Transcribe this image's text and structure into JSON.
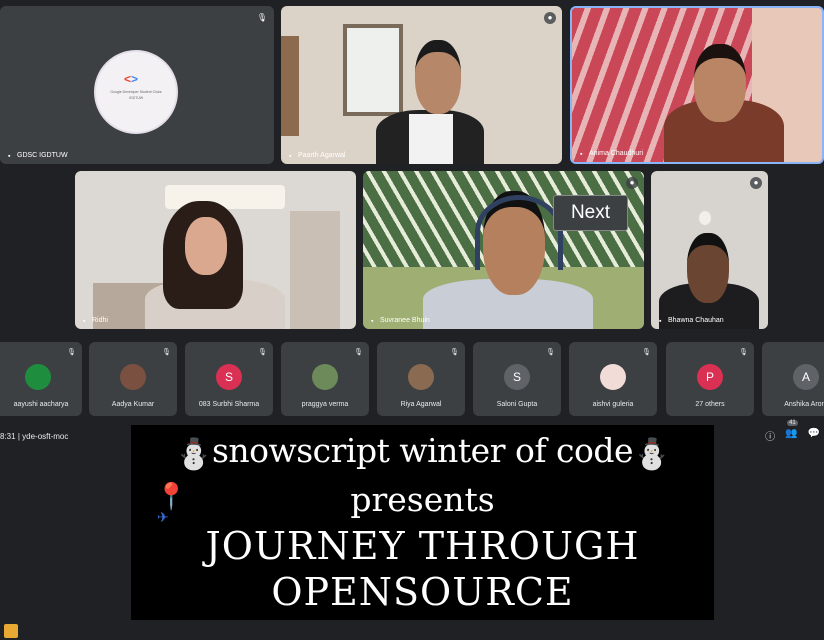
{
  "tiles": {
    "gdsc": {
      "name": "GDSC IGDTUW",
      "logo_text": "Google Developer Student Clubs",
      "logo_sub": "IGDTUW"
    },
    "parth": {
      "name": "Paarth Agarwal"
    },
    "anima": {
      "name": "Anima Chaudhuri"
    },
    "ridhi": {
      "name": "Ridhi"
    },
    "suvranee": {
      "name": "Suvranee Bhuin"
    },
    "bhawna": {
      "name": "Bhawna Chauhan"
    }
  },
  "participants": [
    {
      "name": "aayushi aacharya",
      "initial": "",
      "color": "#1e8e3e"
    },
    {
      "name": "Aadya Kumar",
      "initial": "",
      "color": "#7a5040"
    },
    {
      "name": "083 Surbhi Sharma",
      "initial": "S",
      "color": "#d93054"
    },
    {
      "name": "praggya verma",
      "initial": "",
      "color": "#6d8a5b"
    },
    {
      "name": "Riya Agarwal",
      "initial": "",
      "color": "#8a6a50"
    },
    {
      "name": "Saloni Gupta",
      "initial": "S",
      "color": "#5f6368"
    },
    {
      "name": "aishvi guleria",
      "initial": "",
      "color": "#f1dcd8"
    },
    {
      "name": "27 others",
      "initial": "P",
      "color": "#d93054"
    },
    {
      "name": "Anshika Arora",
      "initial": "A",
      "color": "#5f6368"
    }
  ],
  "tooltip": {
    "next": "Next"
  },
  "meeting": {
    "time": "8:31",
    "code": "yde-osft-moc",
    "people_count": "41"
  },
  "banner": {
    "line1": "snowscript winter of code",
    "line2": "presents",
    "line3": "JOURNEY THROUGH",
    "line4": "OPENSOURCE"
  },
  "icons": [
    "info-icon",
    "people-icon",
    "chat-icon",
    "pin-icon",
    "snowman-icon",
    "location-pin-icon",
    "airplane-icon"
  ]
}
